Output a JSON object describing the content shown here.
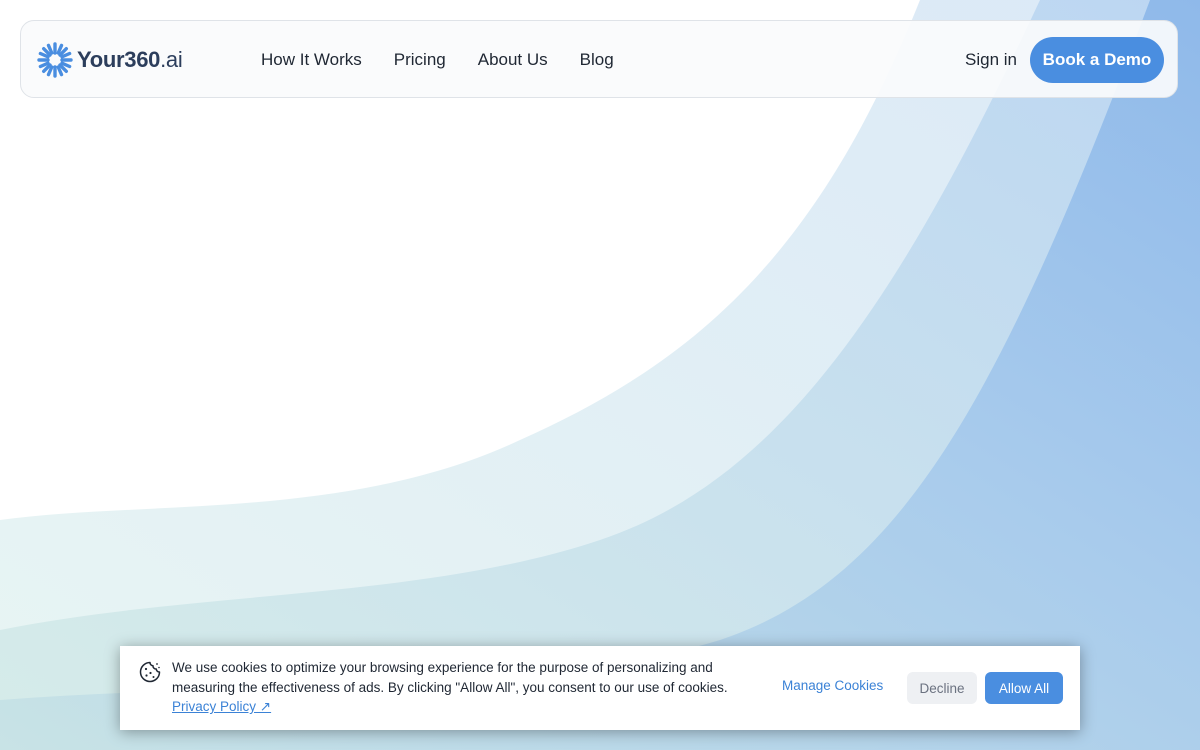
{
  "brand": {
    "name_main": "Your360",
    "name_suffix": ".ai",
    "logo_icon": "starburst-logo-icon",
    "accent_color": "#4a8ee0"
  },
  "nav": {
    "items": [
      {
        "label": "How It Works"
      },
      {
        "label": "Pricing"
      },
      {
        "label": "About Us"
      },
      {
        "label": "Blog"
      }
    ],
    "sign_in": "Sign in",
    "cta": "Book a Demo"
  },
  "cookie_banner": {
    "icon": "cookie-icon",
    "text": "We use cookies to optimize your browsing experience for the purpose of personalizing and measuring the effectiveness of ads. By clicking \"Allow All\", you consent to our use of cookies.",
    "privacy_link": "Privacy Policy ↗",
    "manage": "Manage Cookies",
    "decline": "Decline",
    "allow": "Allow All"
  }
}
